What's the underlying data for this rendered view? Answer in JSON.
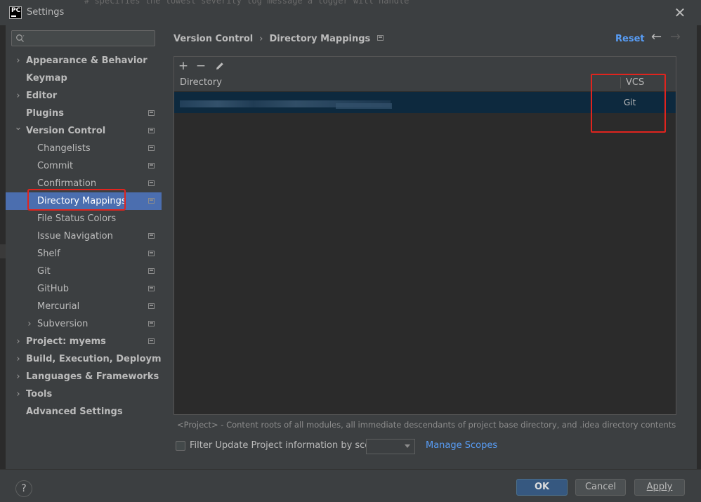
{
  "window": {
    "title": "Settings",
    "app_logo_text": "PC",
    "background_code": "# specifies the lowest severity log message a logger will handle"
  },
  "sidebar": {
    "search_placeholder": "",
    "items": [
      {
        "label": "Appearance & Behavior",
        "level": 0,
        "expandable": true,
        "expanded": false,
        "project_icon": false
      },
      {
        "label": "Keymap",
        "level": 0,
        "expandable": false,
        "project_icon": false
      },
      {
        "label": "Editor",
        "level": 0,
        "expandable": true,
        "expanded": false,
        "project_icon": false
      },
      {
        "label": "Plugins",
        "level": 0,
        "expandable": false,
        "project_icon": true
      },
      {
        "label": "Version Control",
        "level": 0,
        "expandable": true,
        "expanded": true,
        "project_icon": true
      },
      {
        "label": "Changelists",
        "level": 1,
        "expandable": false,
        "project_icon": true
      },
      {
        "label": "Commit",
        "level": 1,
        "expandable": false,
        "project_icon": true
      },
      {
        "label": "Confirmation",
        "level": 1,
        "expandable": false,
        "project_icon": true
      },
      {
        "label": "Directory Mappings",
        "level": 1,
        "expandable": false,
        "project_icon": true,
        "selected": true
      },
      {
        "label": "File Status Colors",
        "level": 1,
        "expandable": false,
        "project_icon": false
      },
      {
        "label": "Issue Navigation",
        "level": 1,
        "expandable": false,
        "project_icon": true
      },
      {
        "label": "Shelf",
        "level": 1,
        "expandable": false,
        "project_icon": true
      },
      {
        "label": "Git",
        "level": 1,
        "expandable": false,
        "project_icon": true
      },
      {
        "label": "GitHub",
        "level": 1,
        "expandable": false,
        "project_icon": true
      },
      {
        "label": "Mercurial",
        "level": 1,
        "expandable": false,
        "project_icon": true
      },
      {
        "label": "Subversion",
        "level": 1,
        "expandable": true,
        "expanded": false,
        "project_icon": true
      },
      {
        "label": "Project: myems",
        "level": 0,
        "expandable": true,
        "expanded": false,
        "project_icon": true
      },
      {
        "label": "Build, Execution, Deployment",
        "level": 0,
        "expandable": true,
        "expanded": false,
        "project_icon": false
      },
      {
        "label": "Languages & Frameworks",
        "level": 0,
        "expandable": true,
        "expanded": false,
        "project_icon": false
      },
      {
        "label": "Tools",
        "level": 0,
        "expandable": true,
        "expanded": false,
        "project_icon": false
      },
      {
        "label": "Advanced Settings",
        "level": 0,
        "expandable": false,
        "project_icon": false
      }
    ]
  },
  "content": {
    "breadcrumb": [
      "Version Control",
      "Directory Mappings"
    ],
    "reset_label": "Reset",
    "table": {
      "columns": [
        "Directory",
        "VCS"
      ],
      "rows": [
        {
          "directory": "",
          "vcs": "Git"
        }
      ]
    },
    "note": "<Project> - Content roots of all modules, all immediate descendants of project base directory, and .idea directory contents",
    "filter_label": "Filter Update Project information by scope",
    "scope_value": "",
    "manage_scopes_label": "Manage Scopes"
  },
  "footer": {
    "help_label": "?",
    "ok_label": "OK",
    "cancel_label": "Cancel",
    "apply_label": "Apply"
  },
  "colors": {
    "selection": "#4b6eaf",
    "link": "#589df6",
    "annotation_box": "#e0241e"
  }
}
